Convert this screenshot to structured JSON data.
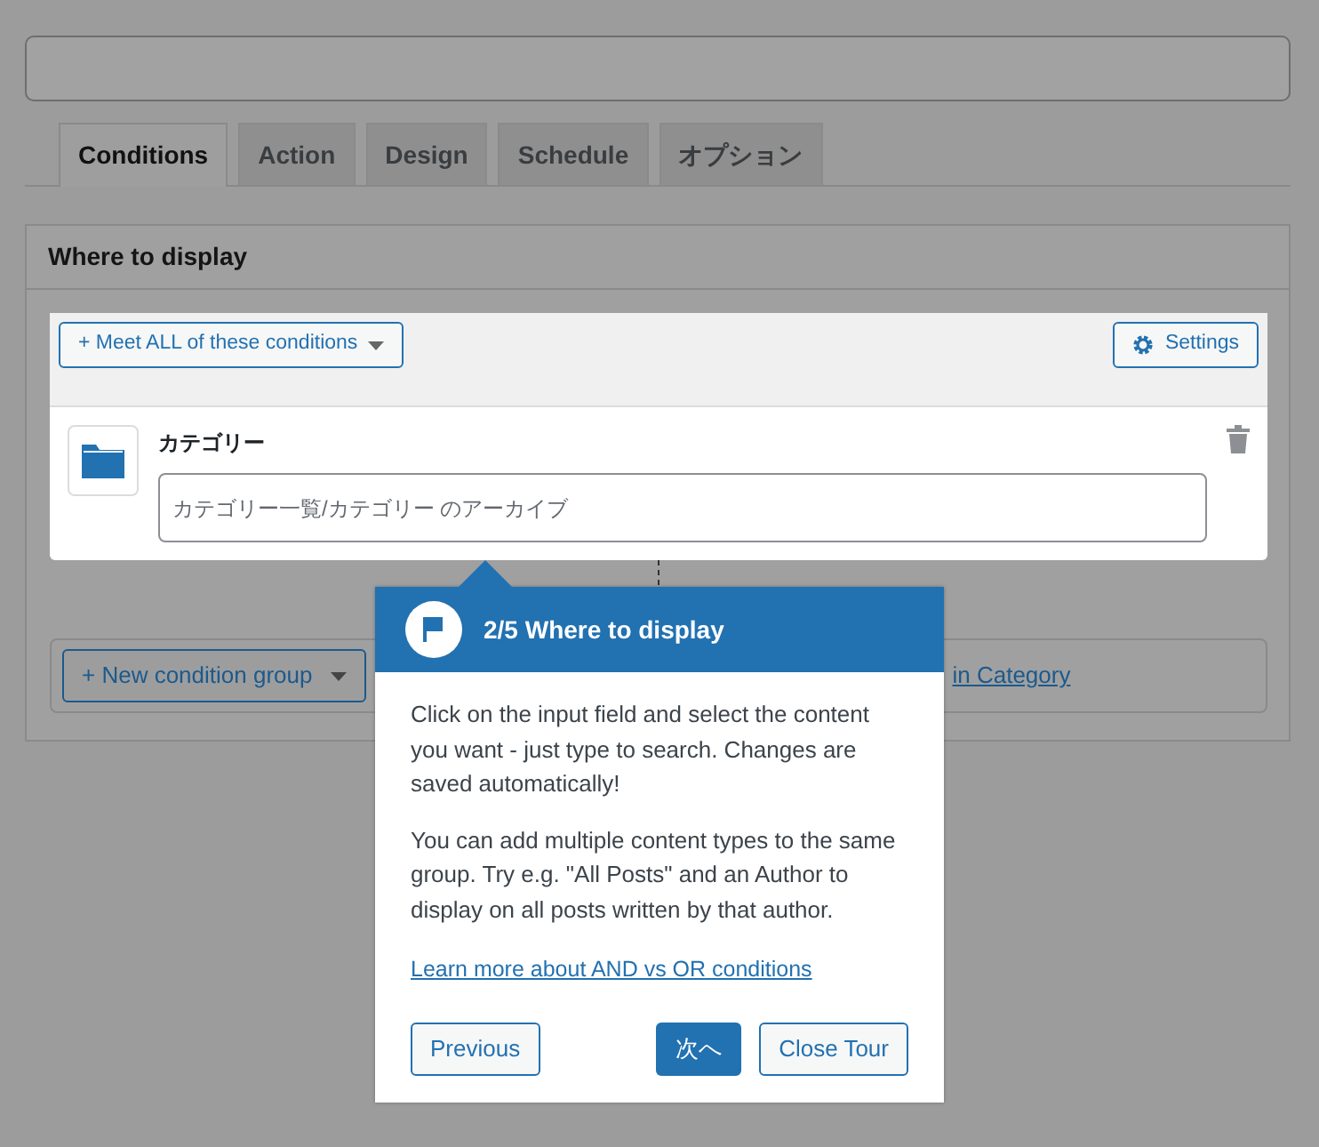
{
  "tabs": [
    {
      "label": "Conditions",
      "selected": true
    },
    {
      "label": "Action",
      "selected": false
    },
    {
      "label": "Design",
      "selected": false
    },
    {
      "label": "Schedule",
      "selected": false
    },
    {
      "label": "オプション",
      "selected": false
    }
  ],
  "panel": {
    "title": "Where to display",
    "group": {
      "match_button": "+ Meet ALL of these conditions",
      "settings_button": "Settings",
      "conditions": [
        {
          "label": "カテゴリー",
          "placeholder": "カテゴリー一覧/カテゴリー のアーカイブ"
        }
      ]
    },
    "new_group_button": "+ New condition group",
    "link": "in Category"
  },
  "tour": {
    "title": "2/5 Where to display",
    "paragraphs": [
      "Click on the input field and select the content you want - just type to search. Changes are saved automatically!",
      "You can add multiple content types to the same group. Try e.g. \"All Posts\" and an Author to display on all posts written by that author."
    ],
    "link": "Learn more about AND vs OR conditions",
    "buttons": [
      {
        "label": "Previous",
        "kind": "outline"
      },
      {
        "label": "次へ",
        "kind": "primary"
      },
      {
        "label": "Close Tour",
        "kind": "outline"
      }
    ]
  }
}
